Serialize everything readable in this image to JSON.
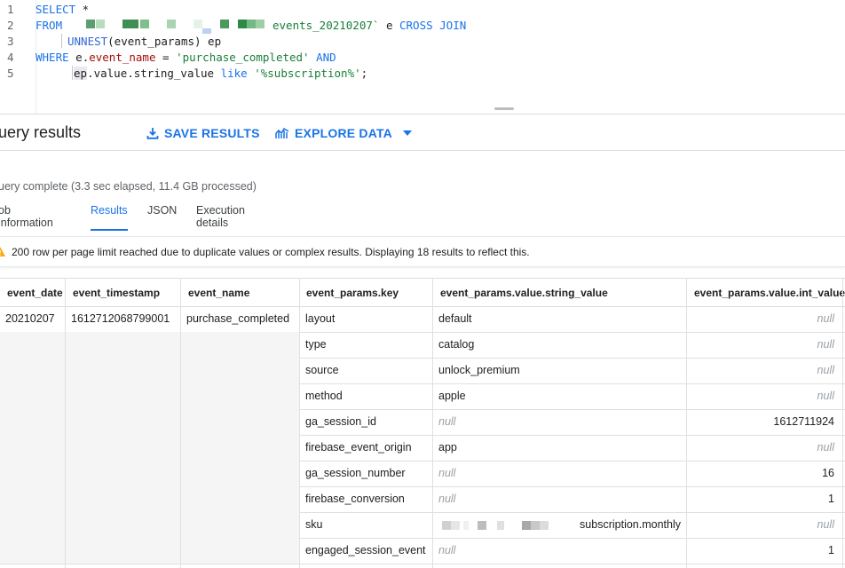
{
  "editor": {
    "line_numbers": [
      "1",
      "2",
      "3",
      "4",
      "5"
    ],
    "line1_kw": "SELECT",
    "line1_rest": " *",
    "line2_kw": "FROM",
    "line2_table": "events_20210207`",
    "line2_alias": " e ",
    "line2_join": "CROSS JOIN",
    "line3_fn": "UNNEST",
    "line3_rest": "(event_params) ep",
    "line4_kw": "WHERE",
    "line4_e": " e.",
    "line4_field": "event_name",
    "line4_eq": " = ",
    "line4_str": "'purchase_completed'",
    "line4_and": " AND",
    "line5_ep": "ep",
    "line5_path": ".value.string_value ",
    "line5_like": "like",
    "line5_str": " '%subscription%'",
    "line5_end": ";"
  },
  "results": {
    "title": "uery results",
    "save_label": "SAVE RESULTS",
    "explore_label": "EXPLORE DATA",
    "status": "uery complete (3.3 sec elapsed, 11.4 GB processed)",
    "tabs": [
      "ob information",
      "Results",
      "JSON",
      "Execution details"
    ],
    "warning": "200 row per page limit reached due to duplicate values or complex results. Displaying 18 results to reflect this."
  },
  "table": {
    "columns": [
      "event_date",
      "event_timestamp",
      "event_name",
      "event_params.key",
      "event_params.value.string_value",
      "event_params.value.int_value"
    ],
    "first_row": {
      "event_date": "20210207",
      "event_timestamp": "1612712068799001",
      "event_name": "purchase_completed"
    },
    "rows": [
      {
        "key": "layout",
        "string_value": "default",
        "int_value": "null"
      },
      {
        "key": "type",
        "string_value": "catalog",
        "int_value": "null"
      },
      {
        "key": "source",
        "string_value": "unlock_premium",
        "int_value": "null"
      },
      {
        "key": "method",
        "string_value": "apple",
        "int_value": "null"
      },
      {
        "key": "ga_session_id",
        "string_value": "null",
        "int_value": "1612711924"
      },
      {
        "key": "firebase_event_origin",
        "string_value": "app",
        "int_value": "null"
      },
      {
        "key": "ga_session_number",
        "string_value": "null",
        "int_value": "16"
      },
      {
        "key": "firebase_conversion",
        "string_value": "null",
        "int_value": "1"
      },
      {
        "key": "sku",
        "string_value": "subscription.monthly",
        "int_value": "null"
      },
      {
        "key": "engaged_session_event",
        "string_value": "null",
        "int_value": "1"
      }
    ]
  },
  "colors": {
    "accent": "#1a73e8",
    "warning": "#f9ab00"
  }
}
